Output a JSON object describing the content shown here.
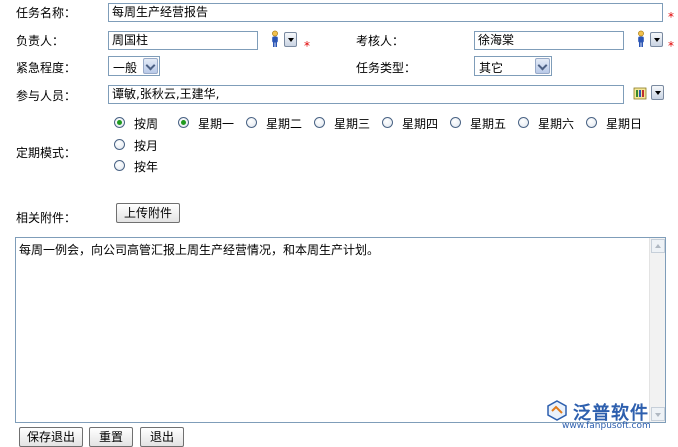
{
  "form": {
    "task_name": {
      "label": "任务名称：",
      "value": "每周生产经营报告"
    },
    "owner": {
      "label": "负责人：",
      "value": "周国柱"
    },
    "reviewer": {
      "label": "考核人：",
      "value": "徐海棠"
    },
    "urgency": {
      "label": "紧急程度：",
      "selected": "一般"
    },
    "task_type": {
      "label": "任务类型：",
      "selected": "其它"
    },
    "participants": {
      "label": "参与人员：",
      "value": "谭敏,张秋云,王建华,"
    },
    "schedule": {
      "label": "定期模式：",
      "modes": [
        {
          "label": "按周",
          "checked": true
        },
        {
          "label": "按月",
          "checked": false
        },
        {
          "label": "按年",
          "checked": false
        }
      ],
      "weekdays": [
        {
          "label": "星期一",
          "checked": true
        },
        {
          "label": "星期二",
          "checked": false
        },
        {
          "label": "星期三",
          "checked": false
        },
        {
          "label": "星期四",
          "checked": false
        },
        {
          "label": "星期五",
          "checked": false
        },
        {
          "label": "星期六",
          "checked": false
        },
        {
          "label": "星期日",
          "checked": false
        }
      ]
    },
    "attachment": {
      "label": "相关附件：",
      "upload_label": "上传附件"
    },
    "description": "每周一例会，向公司高管汇报上周生产经营情况，和本周生产计划。",
    "required_mark": "*"
  },
  "actions": {
    "save_exit": "保存退出",
    "reset": "重置",
    "exit": "退出"
  },
  "watermark": {
    "brand": "泛普软件",
    "url": "www.fanpusoft.com"
  },
  "colors": {
    "required": "#e00000",
    "radio_checked": "#1f9a1f",
    "border": "#7f9db9",
    "brand": "#2d5fae"
  }
}
